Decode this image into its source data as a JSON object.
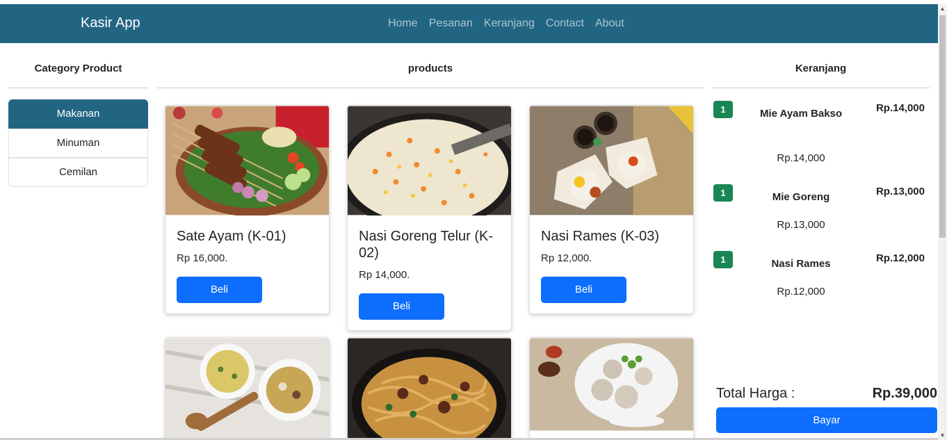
{
  "navbar": {
    "brand": "Kasir App",
    "links": [
      "Home",
      "Pesanan",
      "Keranjang",
      "Contact",
      "About"
    ]
  },
  "categories": {
    "title": "Category Product",
    "items": [
      {
        "label": "Makanan",
        "active": true
      },
      {
        "label": "Minuman",
        "active": false
      },
      {
        "label": "Cemilan",
        "active": false
      }
    ]
  },
  "products": {
    "title": "products",
    "button_label": "Beli",
    "items": [
      {
        "name": "Sate Ayam (K-01)",
        "price": "Rp 16,000."
      },
      {
        "name": "Nasi Goreng Telur (K-02)",
        "price": "Rp 14,000."
      },
      {
        "name": "Nasi Rames (K-03)",
        "price": "Rp 12,000."
      }
    ]
  },
  "cart": {
    "title": "Keranjang",
    "items": [
      {
        "qty": "1",
        "name": "Mie Ayam Bakso",
        "unit_price": "Rp.14,000",
        "total": "Rp.14,000"
      },
      {
        "qty": "1",
        "name": "Mie Goreng",
        "unit_price": "Rp.13,000",
        "total": "Rp.13,000"
      },
      {
        "qty": "1",
        "name": "Nasi Rames",
        "unit_price": "Rp.12,000",
        "total": "Rp.12,000"
      }
    ],
    "total_label": "Total Harga :",
    "total_value": "Rp.39,000",
    "pay_label": "Bayar"
  },
  "colors": {
    "navbar": "#226583",
    "primary": "#0d6efd",
    "badge": "#198754"
  }
}
